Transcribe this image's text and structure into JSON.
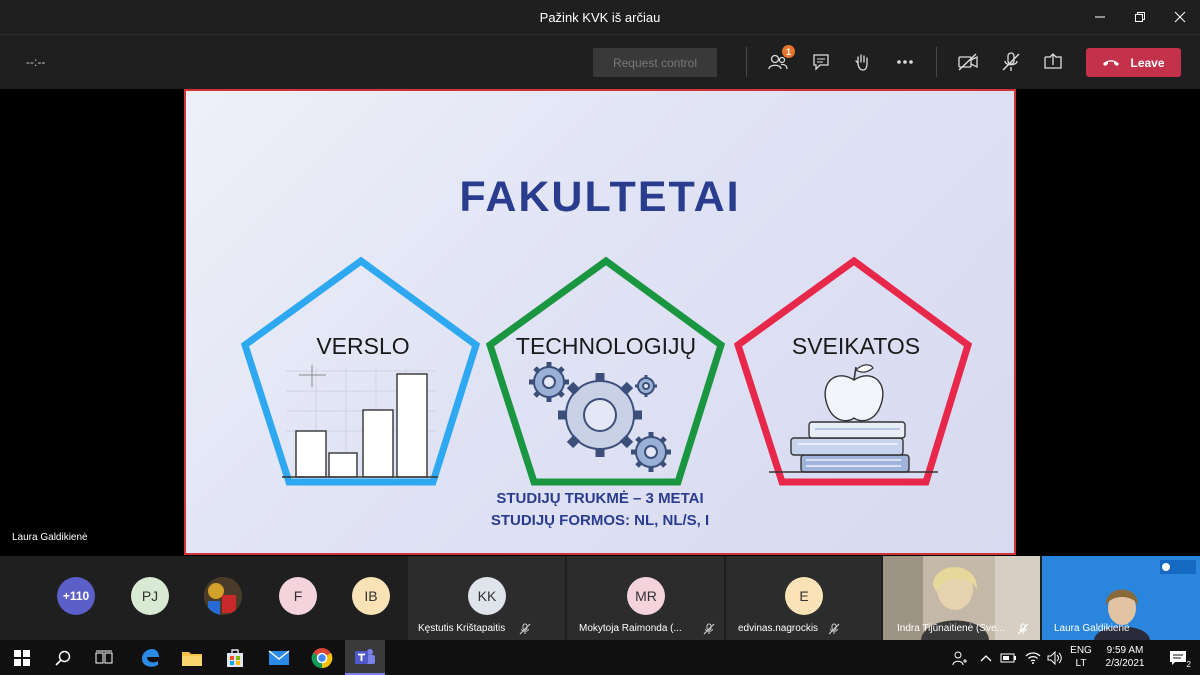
{
  "window": {
    "title": "Pažink KVK iš arčiau"
  },
  "toolbar": {
    "timer": "--:--",
    "request_control": "Request control",
    "participants_badge": "1",
    "leave_label": "Leave"
  },
  "slide": {
    "title": "FAKULTETAI",
    "faculties": [
      {
        "label": "VERSLO",
        "color": "#2ea8f0"
      },
      {
        "label": "TECHNOLOGIJŲ",
        "color": "#1a9641"
      },
      {
        "label": "SVEIKATOS",
        "color": "#e8284a"
      }
    ],
    "duration": "STUDIJŲ TRUKMĖ – 3 METAI",
    "forms": "STUDIJŲ FORMOS: NL, NL/S, I"
  },
  "presenter": {
    "name": "Laura Galdikienė"
  },
  "participants": {
    "overflow": "+110",
    "avatars": [
      {
        "initials": "PJ",
        "color": "#d8ead3"
      },
      {
        "initials": "F",
        "color": "#f4d3dc"
      },
      {
        "initials": "IB",
        "color": "#f8e2b6"
      }
    ],
    "tiles": [
      {
        "initials": "KK",
        "color": "#dfe3ea",
        "name": "Kęstutis Krištapaitis"
      },
      {
        "initials": "MR",
        "color": "#f4d3dc",
        "name": "Mokytoja Raimonda (..."
      },
      {
        "initials": "E",
        "color": "#f8e2b6",
        "name": "edvinas.nagrockis"
      }
    ],
    "video": [
      {
        "name": "Indra Tijūnaitienė (Sve..."
      },
      {
        "name": "Laura Galdikienė"
      }
    ]
  },
  "taskbar": {
    "lang": "ENG",
    "layout": "LT",
    "time": "9:59 AM",
    "date": "2/3/2021",
    "notifications": "2"
  },
  "colors": {
    "leave": "#c4314b",
    "slide_border": "#d13438",
    "title": "#2a3c8e"
  }
}
